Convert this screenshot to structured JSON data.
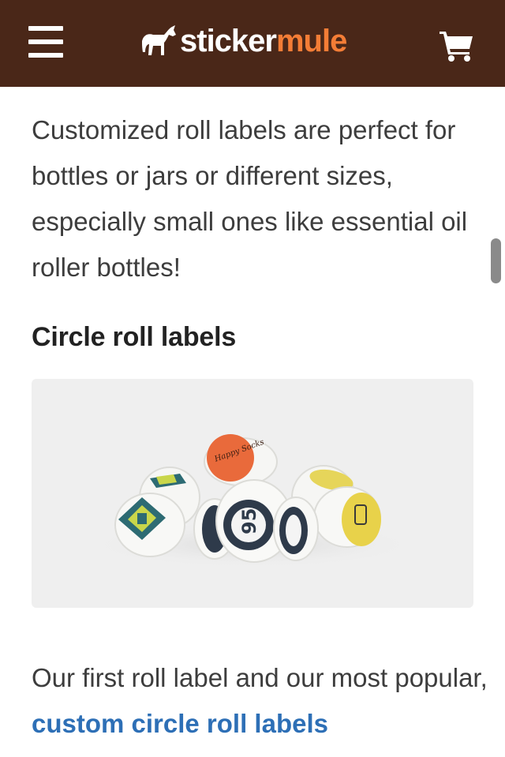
{
  "header": {
    "logo_left": "sticker",
    "logo_right": "mule",
    "menu_icon": "hamburger-menu-icon",
    "cart_icon": "shopping-cart-icon"
  },
  "colors": {
    "header_bg": "#4a2718",
    "brand_orange": "#f47d36",
    "link_blue": "#2d6fb6"
  },
  "main": {
    "intro_paragraph": "Customized roll labels are perfect for bottles or jars or different sizes, especially small ones like essential oil roller bottles!",
    "section_heading": "Circle roll labels",
    "image": {
      "label_script_text": "Happy Socks"
    },
    "para2_text": "Our first roll label and our most popular, ",
    "para2_link": "custom circle roll labels"
  }
}
